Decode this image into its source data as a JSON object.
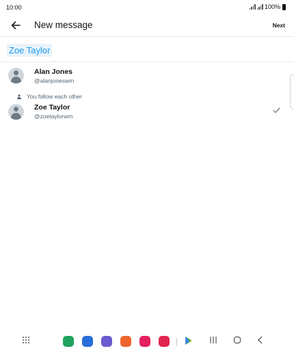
{
  "status": {
    "time": "10:00",
    "battery": "100%"
  },
  "header": {
    "title": "New message",
    "next_label": "Next"
  },
  "search": {
    "value": "Zoe Taylor"
  },
  "contacts": [
    {
      "name": "Alan Jones",
      "handle": "@alanjoneswm",
      "social_context": "",
      "selected": false
    },
    {
      "name": "Zoe Taylor",
      "handle": "@zoetaylorwm",
      "social_context": "You follow each other",
      "selected": true
    }
  ],
  "navbar": {
    "apps": [
      {
        "icon": "phone-app-icon",
        "color": "#1fa35c"
      },
      {
        "icon": "messages-app-icon",
        "color": "#2a6fdb"
      },
      {
        "icon": "internet-app-icon",
        "color": "#6a5acd"
      },
      {
        "icon": "notes-app-icon",
        "color": "#f0642e"
      },
      {
        "icon": "flower-app-icon",
        "color": "#e4205f"
      },
      {
        "icon": "camera-app-icon",
        "color": "#e0254f"
      }
    ]
  },
  "colors": {
    "accent": "#1d9bf0",
    "chip_bg": "#e8f3fb",
    "muted": "#536471"
  }
}
